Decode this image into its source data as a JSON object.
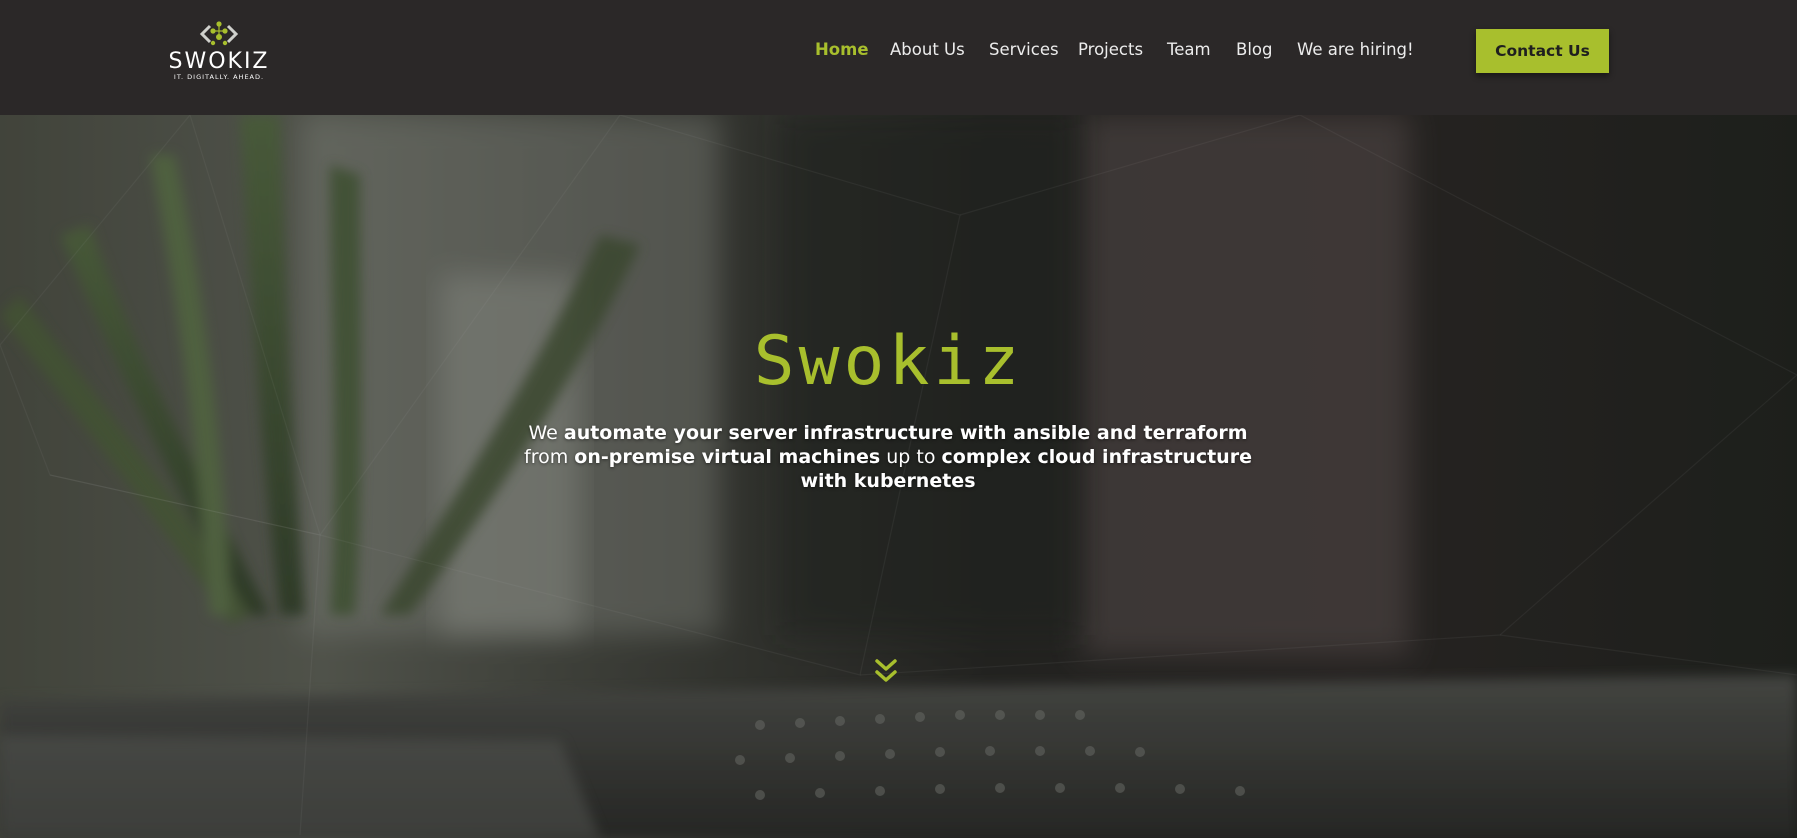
{
  "brand": {
    "name": "SWOKIZ",
    "tagline": "IT. DIGITALLY. AHEAD.",
    "accent_color": "#a8bf2d"
  },
  "nav": {
    "items": [
      {
        "label": "Home",
        "active": true
      },
      {
        "label": "About Us",
        "active": false
      },
      {
        "label": "Services",
        "active": false
      },
      {
        "label": "Projects",
        "active": false
      },
      {
        "label": "Team",
        "active": false
      },
      {
        "label": "Blog",
        "active": false
      },
      {
        "label": "We are hiring!",
        "active": false
      }
    ],
    "contact_label": "Contact Us"
  },
  "hero": {
    "title": "Swokiz",
    "line1_a": "We ",
    "line1_b": "automate your server infrastructure with ansible and terraform",
    "line2_a": "from ",
    "line2_b": "on-premise virtual machines",
    "line2_c": " up to ",
    "line2_d": "complex cloud infrastructure",
    "line3": "with kubernetes",
    "scroll_icon": "double-chevron-down-icon"
  }
}
